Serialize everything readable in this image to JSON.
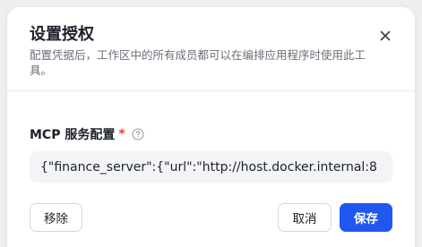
{
  "dialog": {
    "title": "设置授权",
    "subtitle": "配置凭据后，工作区中的所有成员都可以在编排应用程序时使用此工具。",
    "close_icon": "close-icon"
  },
  "form": {
    "field_label": "MCP 服务配置",
    "required_mark": "*",
    "help_icon": "question-circle-icon",
    "config_value": "{\"finance_server\":{\"url\":\"http://host.docker.internal:8"
  },
  "footer": {
    "remove_label": "移除",
    "cancel_label": "取消",
    "save_label": "保存"
  },
  "colors": {
    "primary": "#1f57f0",
    "required": "#e0413e",
    "input_bg": "#f3f4f6"
  }
}
